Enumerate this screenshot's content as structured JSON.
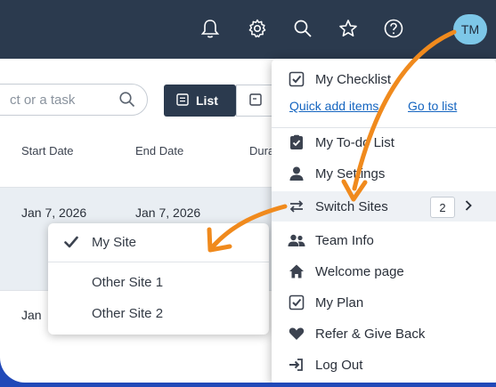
{
  "topbar": {
    "icons": [
      "bell-icon",
      "gear-icon",
      "search-icon",
      "star-icon",
      "help-icon"
    ],
    "avatar_initials": "TM"
  },
  "toolbar": {
    "search_placeholder": "ct or a task",
    "list_label": "List"
  },
  "table": {
    "headers": [
      "Start Date",
      "End Date",
      "Dura"
    ],
    "rows": [
      {
        "start": "Jan 7, 2026",
        "end": "Jan 7, 2026"
      },
      {
        "start": "Jan",
        "end": ""
      }
    ]
  },
  "site_menu": {
    "items": [
      {
        "label": "My Site",
        "selected": true
      },
      {
        "label": "Other Site 1",
        "selected": false
      },
      {
        "label": "Other Site 2",
        "selected": false
      }
    ]
  },
  "user_menu": {
    "checklist_label": "My Checklist",
    "quick_add_label": "Quick add items",
    "go_to_list_label": "Go to list",
    "todo_label": "My To-do List",
    "settings_label": "My Settings",
    "switch_sites_label": "Switch Sites",
    "switch_sites_count": "2",
    "team_info_label": "Team Info",
    "welcome_label": "Welcome page",
    "plan_label": "My Plan",
    "refer_label": "Refer & Give Back",
    "logout_label": "Log Out"
  },
  "colors": {
    "topbar": "#2b3a4e",
    "accent_arrow": "#f08a1d",
    "link": "#1565c0",
    "avatar": "#7dc7e8",
    "background": "#2149b8"
  }
}
